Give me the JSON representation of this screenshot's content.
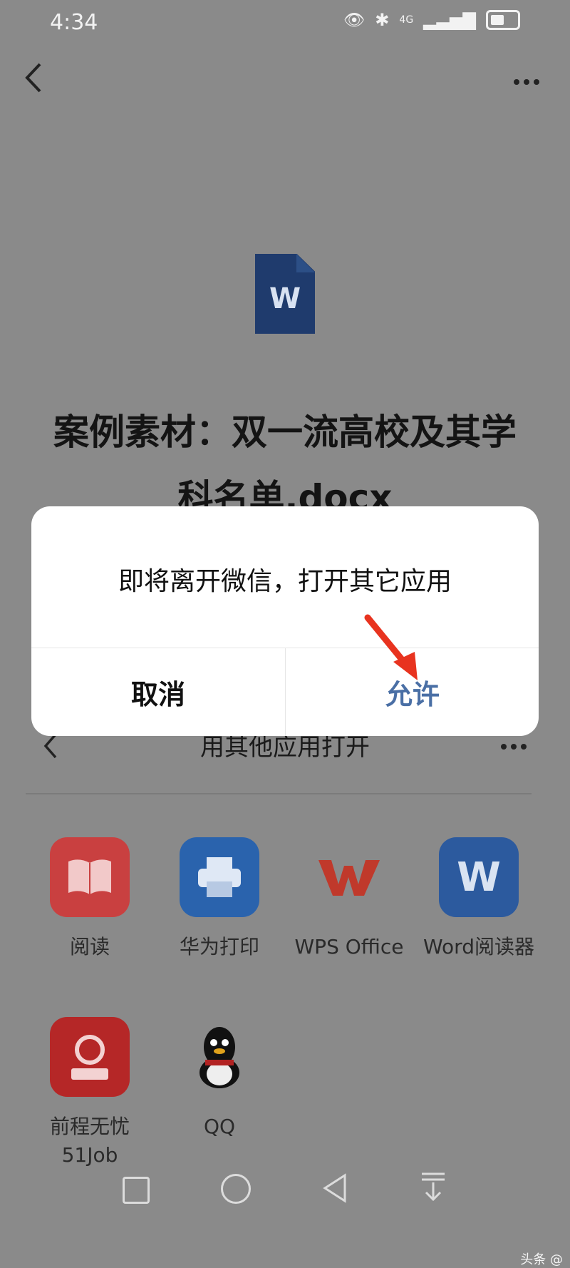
{
  "status_bar": {
    "time": "4:34",
    "network": "4G"
  },
  "document": {
    "file_icon_letter": "W",
    "title": "案例素材：双一流高校及其学科名单.docx"
  },
  "sheet": {
    "title": "用其他应用打开",
    "apps": [
      {
        "label": "阅读",
        "icon": "book-icon",
        "color": "#d94b4b"
      },
      {
        "label": "华为打印",
        "icon": "printer-icon",
        "color": "#2d6dbd"
      },
      {
        "label": "WPS Office",
        "icon": "wps-logo-icon",
        "color": "#c83d3d"
      },
      {
        "label": "Word阅读器",
        "icon": "word-reader-icon",
        "color": "#2f5ea8"
      },
      {
        "label": "前程无忧51Job",
        "icon": "51job-logo-icon",
        "color": "#c62828"
      },
      {
        "label": "QQ",
        "icon": "qq-penguin-icon",
        "color": "#111111"
      }
    ]
  },
  "dialog": {
    "message": "即将离开微信，打开其它应用",
    "cancel_label": "取消",
    "allow_label": "允许"
  },
  "watermark": "头条 @"
}
